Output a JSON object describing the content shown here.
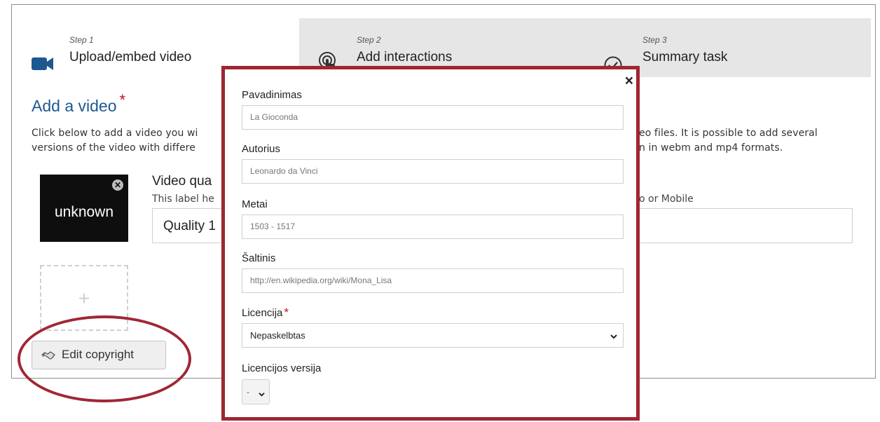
{
  "tabs": [
    {
      "step": "Step 1",
      "label": "Upload/embed video",
      "icon": "video-camera-icon"
    },
    {
      "step": "Step 2",
      "label": "Add interactions",
      "icon": "touch-pointer-icon"
    },
    {
      "step": "Step 3",
      "label": "Summary task",
      "icon": "check-circle-icon"
    }
  ],
  "main": {
    "title": "Add a video",
    "required_mark": "*",
    "desc_line1_left": "Click below to add a video you wi",
    "desc_line1_right": "eo files. It is possible to add several",
    "desc_line2_left": "versions of the video with differe",
    "desc_line2_right": "n in webm and mp4 formats.",
    "video_thumb_label": "unknown",
    "remove_icon": "close-circle-icon",
    "quality_label": "Video qua",
    "quality_desc_left": "This label he",
    "quality_desc_right": "o or Mobile",
    "quality_value": "Quality 1",
    "add_plus": "+",
    "copyright_button": "Edit copyright",
    "copyright_icon": "handshake-icon"
  },
  "dialog": {
    "close": "×",
    "fields": [
      {
        "label": "Pavadinimas",
        "value": "La Gioconda"
      },
      {
        "label": "Autorius",
        "value": "Leonardo da Vinci"
      },
      {
        "label": "Metai",
        "value": "1503 - 1517"
      },
      {
        "label": "Šaltinis",
        "value": "http://en.wikipedia.org/wiki/Mona_Lisa"
      }
    ],
    "license": {
      "label": "Licencija",
      "required": "*",
      "value": "Nepaskelbtas"
    },
    "license_version": {
      "label": "Licencijos versija",
      "value": "-"
    }
  },
  "colors": {
    "accent_blue": "#1d5891",
    "annotation_red": "#a02734",
    "required_red": "#c0141a",
    "tab_bar_gray": "#e6e6e6"
  }
}
